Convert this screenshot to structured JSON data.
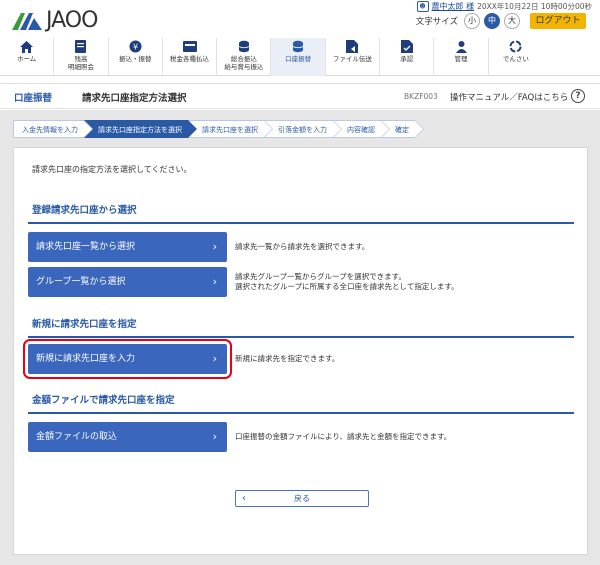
{
  "brand": {
    "logo_text": "JAOO",
    "accent": "#2a5aa6",
    "logo_green": "#3a9b3a"
  },
  "user": {
    "icon": "user-icon",
    "name": "農中太郎 様",
    "datetime": "20XX年10月22日 10時00分00秒"
  },
  "font_size": {
    "label": "文字サイズ",
    "small": "小",
    "medium": "中",
    "large": "大",
    "selected": "中"
  },
  "logout_label": "ログアウト",
  "nav": [
    {
      "label": "ホーム",
      "icon": "home-icon"
    },
    {
      "label": "残高\n明細照会",
      "icon": "passbook-icon"
    },
    {
      "label": "振込・振替",
      "icon": "yen-icon"
    },
    {
      "label": "税金各種払込",
      "icon": "payment-icon"
    },
    {
      "label": "総合振込\n給与賞与振込",
      "icon": "coins-icon"
    },
    {
      "label": "口座振替",
      "icon": "transfer-icon"
    },
    {
      "label": "ファイル伝送",
      "icon": "file-icon"
    },
    {
      "label": "承認",
      "icon": "approve-icon"
    },
    {
      "label": "管理",
      "icon": "admin-icon"
    },
    {
      "label": "でんさい",
      "icon": "densai-icon"
    }
  ],
  "active_nav_index": 5,
  "titlebar": {
    "category": "口座振替",
    "title": "請求先口座指定方法選択",
    "screen_code": "BKZF003",
    "help_text": "操作マニュアル／FAQはこちら",
    "help_icon": "help-icon"
  },
  "steps": [
    {
      "label": "入金先情報を入力",
      "active": false
    },
    {
      "label": "請求先口座指定方法を選択",
      "active": true
    },
    {
      "label": "請求先口座を選択",
      "active": false
    },
    {
      "label": "引落金額を入力",
      "active": false
    },
    {
      "label": "内容確認",
      "active": false
    },
    {
      "label": "確定",
      "active": false
    }
  ],
  "intro": "請求先口座の指定方法を選択してください。",
  "sections": [
    {
      "heading": "登録請求先口座から選択",
      "actions": [
        {
          "label": "請求先口座一覧から選択",
          "desc": "請求先一覧から請求先を選択できます。"
        },
        {
          "label": "グループ一覧から選択",
          "desc": "請求先グループ一覧からグループを選択できます。\n選択されたグループに所属する全口座を請求先として指定します。"
        }
      ]
    },
    {
      "heading": "新規に請求先口座を指定",
      "actions": [
        {
          "label": "新規に請求先口座を入力",
          "desc": "新規に請求先を指定できます。",
          "highlighted": true
        }
      ]
    },
    {
      "heading": "金額ファイルで請求先口座を指定",
      "actions": [
        {
          "label": "金額ファイルの取込",
          "desc": "口座振替の金額ファイルにより、請求先と金額を指定できます。"
        }
      ]
    }
  ],
  "back_label": "戻る",
  "highlight_color": "#e60012"
}
